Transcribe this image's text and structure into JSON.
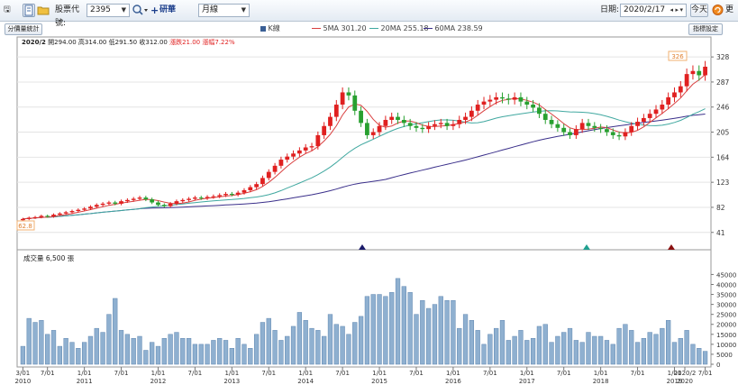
{
  "toolbar": {
    "stock_code_label": "股票代號:",
    "stock_code_value": "2395",
    "stock_name": "研華",
    "period_value": "月線",
    "date_label": "日期:",
    "date_value": "2020/2/17",
    "today_label": "今天",
    "update_label": "更新"
  },
  "legend": {
    "k_label": "K線",
    "ma5": "5MA 301.20",
    "ma20": "20MA 255.18",
    "ma60": "60MA 238.59",
    "colors": {
      "ma5": "#d94040",
      "ma20": "#40a8a0",
      "ma60": "#3a2f8a",
      "up": "#e02020",
      "down": "#28a030"
    }
  },
  "buttons": {
    "volume_stats": "分價量統計",
    "indicator_settings": "指標設定"
  },
  "ohlc": {
    "period": "2020/2",
    "open_label": "開",
    "open": "294.00",
    "high_label": "高",
    "high": "314.00",
    "low_label": "低",
    "low": "291.50",
    "close_label": "收",
    "close": "312.00",
    "change_label": "漲跌",
    "change": "21.00",
    "pct_label": "漲幅",
    "pct": "7.22%"
  },
  "price_axis": [
    "328",
    "287",
    "246",
    "205",
    "164",
    "123",
    "82",
    "41"
  ],
  "volume_axis": [
    "45000",
    "40000",
    "35000",
    "30000",
    "25000",
    "20000",
    "15000",
    "10000",
    "5000",
    "0"
  ],
  "volume_title": "成交量 6,500 張",
  "highlights": {
    "max_label": "326",
    "min_label": "62.8",
    "current_period": "2020/2"
  },
  "chart_data": {
    "type": "candlestick",
    "title": "2395 研華 月線",
    "ylim": [
      20,
      340
    ],
    "volume_ylim": [
      0,
      47000
    ],
    "x_ticks_top": [
      "3/01",
      "7/01",
      "1/01",
      "7/01",
      "1/01",
      "7/01",
      "1/01",
      "7/01",
      "1/01",
      "7/01",
      "1/01",
      "7/01",
      "1/01",
      "7/01",
      "1/01",
      "7/01",
      "1/01",
      "7/01",
      "1/01",
      "7/01",
      "2020/2"
    ],
    "x_ticks_bottom": [
      "2010",
      "",
      "2011",
      "",
      "2012",
      "",
      "2013",
      "",
      "2014",
      "",
      "2015",
      "",
      "2016",
      "",
      "2017",
      "",
      "2018",
      "",
      "2019",
      "",
      "2020"
    ],
    "close": [
      63,
      65,
      66,
      68,
      67,
      70,
      72,
      74,
      76,
      78,
      80,
      83,
      86,
      88,
      90,
      88,
      92,
      94,
      96,
      98,
      95,
      90,
      86,
      84,
      88,
      92,
      94,
      96,
      98,
      97,
      99,
      100,
      102,
      104,
      103,
      106,
      110,
      115,
      120,
      130,
      140,
      150,
      160,
      165,
      170,
      175,
      180,
      182,
      200,
      215,
      230,
      250,
      270,
      265,
      240,
      220,
      200,
      205,
      215,
      225,
      230,
      225,
      220,
      215,
      212,
      210,
      215,
      218,
      220,
      215,
      218,
      225,
      230,
      240,
      250,
      255,
      258,
      262,
      260,
      258,
      262,
      255,
      250,
      245,
      235,
      225,
      218,
      212,
      205,
      200,
      210,
      220,
      215,
      212,
      210,
      205,
      200,
      198,
      205,
      215,
      222,
      228,
      235,
      242,
      250,
      262,
      270,
      280,
      300,
      305,
      298,
      312
    ],
    "volume": [
      9000,
      23000,
      21000,
      22000,
      15000,
      17000,
      9000,
      13000,
      11000,
      8000,
      11000,
      14000,
      18000,
      16000,
      25000,
      33000,
      17000,
      15000,
      13000,
      14000,
      7000,
      11000,
      9000,
      13000,
      15000,
      16000,
      13000,
      13000,
      10000,
      10000,
      10000,
      12000,
      13000,
      12000,
      8000,
      13000,
      10000,
      8000,
      15000,
      21000,
      23000,
      17000,
      12000,
      14000,
      19000,
      26000,
      22000,
      18000,
      17000,
      14000,
      25000,
      20000,
      19000,
      15000,
      21000,
      24000,
      34000,
      35000,
      35000,
      34000,
      36000,
      43000,
      39000,
      36000,
      25000,
      32000,
      28000,
      30000,
      34000,
      32000,
      32000,
      18000,
      25000,
      22000,
      17000,
      10000,
      15000,
      18000,
      22000,
      12000,
      14000,
      17000,
      12000,
      13000,
      19000,
      20000,
      11000,
      14000,
      16000,
      18000,
      12000,
      11000,
      16000,
      14000,
      14000,
      12000,
      10000,
      18000,
      20000,
      17000,
      11000,
      13000,
      16000,
      15000,
      18000,
      22000,
      11000,
      13000,
      17000,
      10000,
      8000,
      6500
    ],
    "ma5_last": 301.2,
    "ma20_last": 255.18,
    "ma60_last": 238.59
  }
}
